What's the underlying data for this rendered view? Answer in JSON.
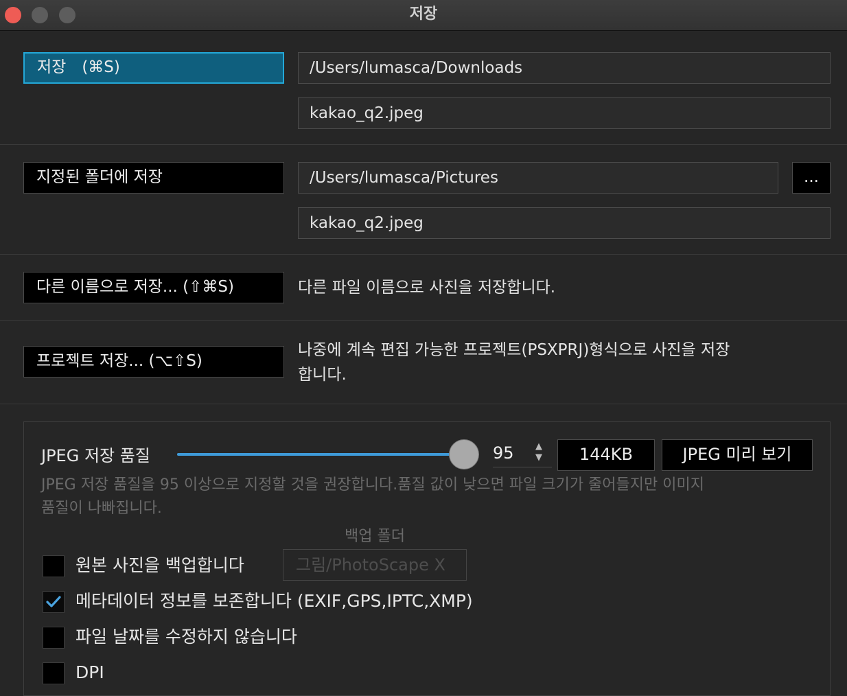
{
  "window": {
    "title": "저장"
  },
  "save": {
    "button_label": "저장　(⌘S)",
    "path": "/Users/lumasca/Downloads",
    "filename": "kakao_q2.jpeg"
  },
  "save_to_folder": {
    "button_label": "지정된 폴더에 저장",
    "path": "/Users/lumasca/Pictures",
    "browse_label": "...",
    "filename": "kakao_q2.jpeg"
  },
  "save_as": {
    "button_label": "다른 이름으로 저장... (⇧⌘S)",
    "description": "다른 파일 이름으로 사진을 저장합니다."
  },
  "save_project": {
    "button_label": "프로젝트 저장... (⌥⇧S)",
    "description_line1": "나중에 계속 편집 가능한 프로젝트(PSXPRJ)형식으로 사진을 저장",
    "description_line2": "합니다."
  },
  "jpeg": {
    "quality_label": "JPEG 저장 품질",
    "quality_value": "95",
    "quality_fraction": 0.95,
    "file_size": "144KB",
    "preview_button": "JPEG 미리 보기",
    "hint_line1": "JPEG 저장 품질을 95 이상으로 지정할 것을 권장합니다.품질 값이 낮으면 파일 크기가 줄어들지만 이미지",
    "hint_line2": "품질이 나빠집니다."
  },
  "backup": {
    "folder_label": "백업 폴더",
    "folder_value": "그림/PhotoScape X"
  },
  "options": [
    {
      "label": "원본 사진을 백업합니다",
      "checked": false
    },
    {
      "label": "메타데이터 정보를 보존합니다 (EXIF,GPS,IPTC,XMP)",
      "checked": true
    },
    {
      "label": "파일 날짜를 수정하지 않습니다",
      "checked": false
    },
    {
      "label": "DPI",
      "checked": false
    }
  ],
  "colors": {
    "accent": "#24a8d8",
    "slider": "#3e9ad8",
    "close": "#ee5c55"
  }
}
